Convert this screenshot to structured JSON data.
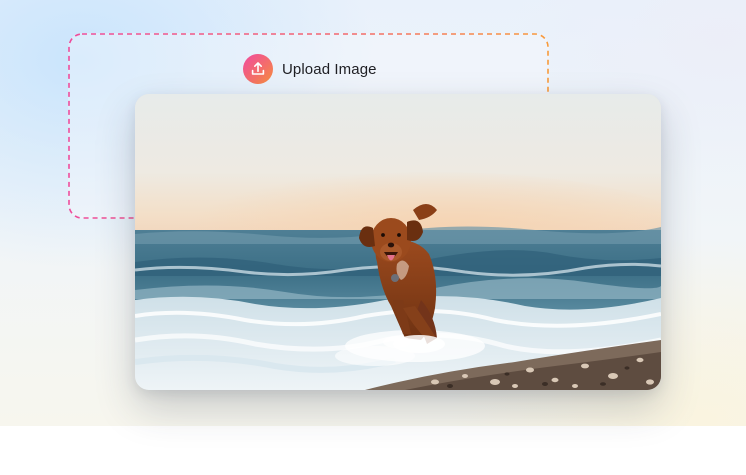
{
  "upload": {
    "label": "Upload Image",
    "icon": "upload-icon",
    "colors": {
      "gradient_start": "#ef4f9a",
      "gradient_end": "#f79a3a"
    }
  },
  "photo": {
    "subject": "dog-running-on-beach",
    "icon": "photo-image"
  }
}
